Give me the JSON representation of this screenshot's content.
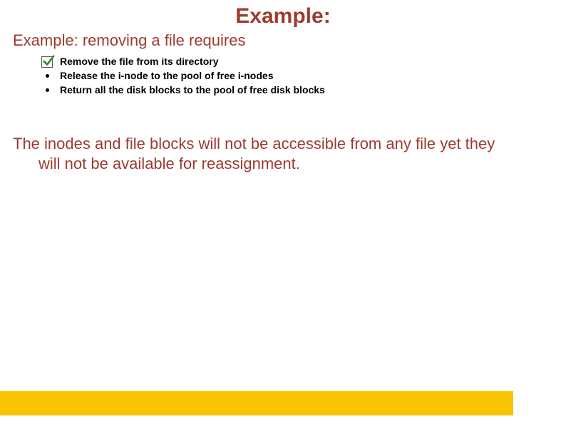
{
  "title": "Example:",
  "subhead": "Example: removing a file requires",
  "items": [
    {
      "marker": "check",
      "text": "Remove the file from its directory"
    },
    {
      "marker": "dot",
      "text": "Release the i-node to the pool of free i-nodes"
    },
    {
      "marker": "dot",
      "text": "Return all the disk blocks to the pool of free disk blocks"
    }
  ],
  "paragraph": {
    "line1": "The inodes and file blocks will not be accessible from any file yet they",
    "line2": "will not be available for reassignment."
  },
  "colors": {
    "heading": "#9c3b2e",
    "accent": "#f6c400"
  }
}
